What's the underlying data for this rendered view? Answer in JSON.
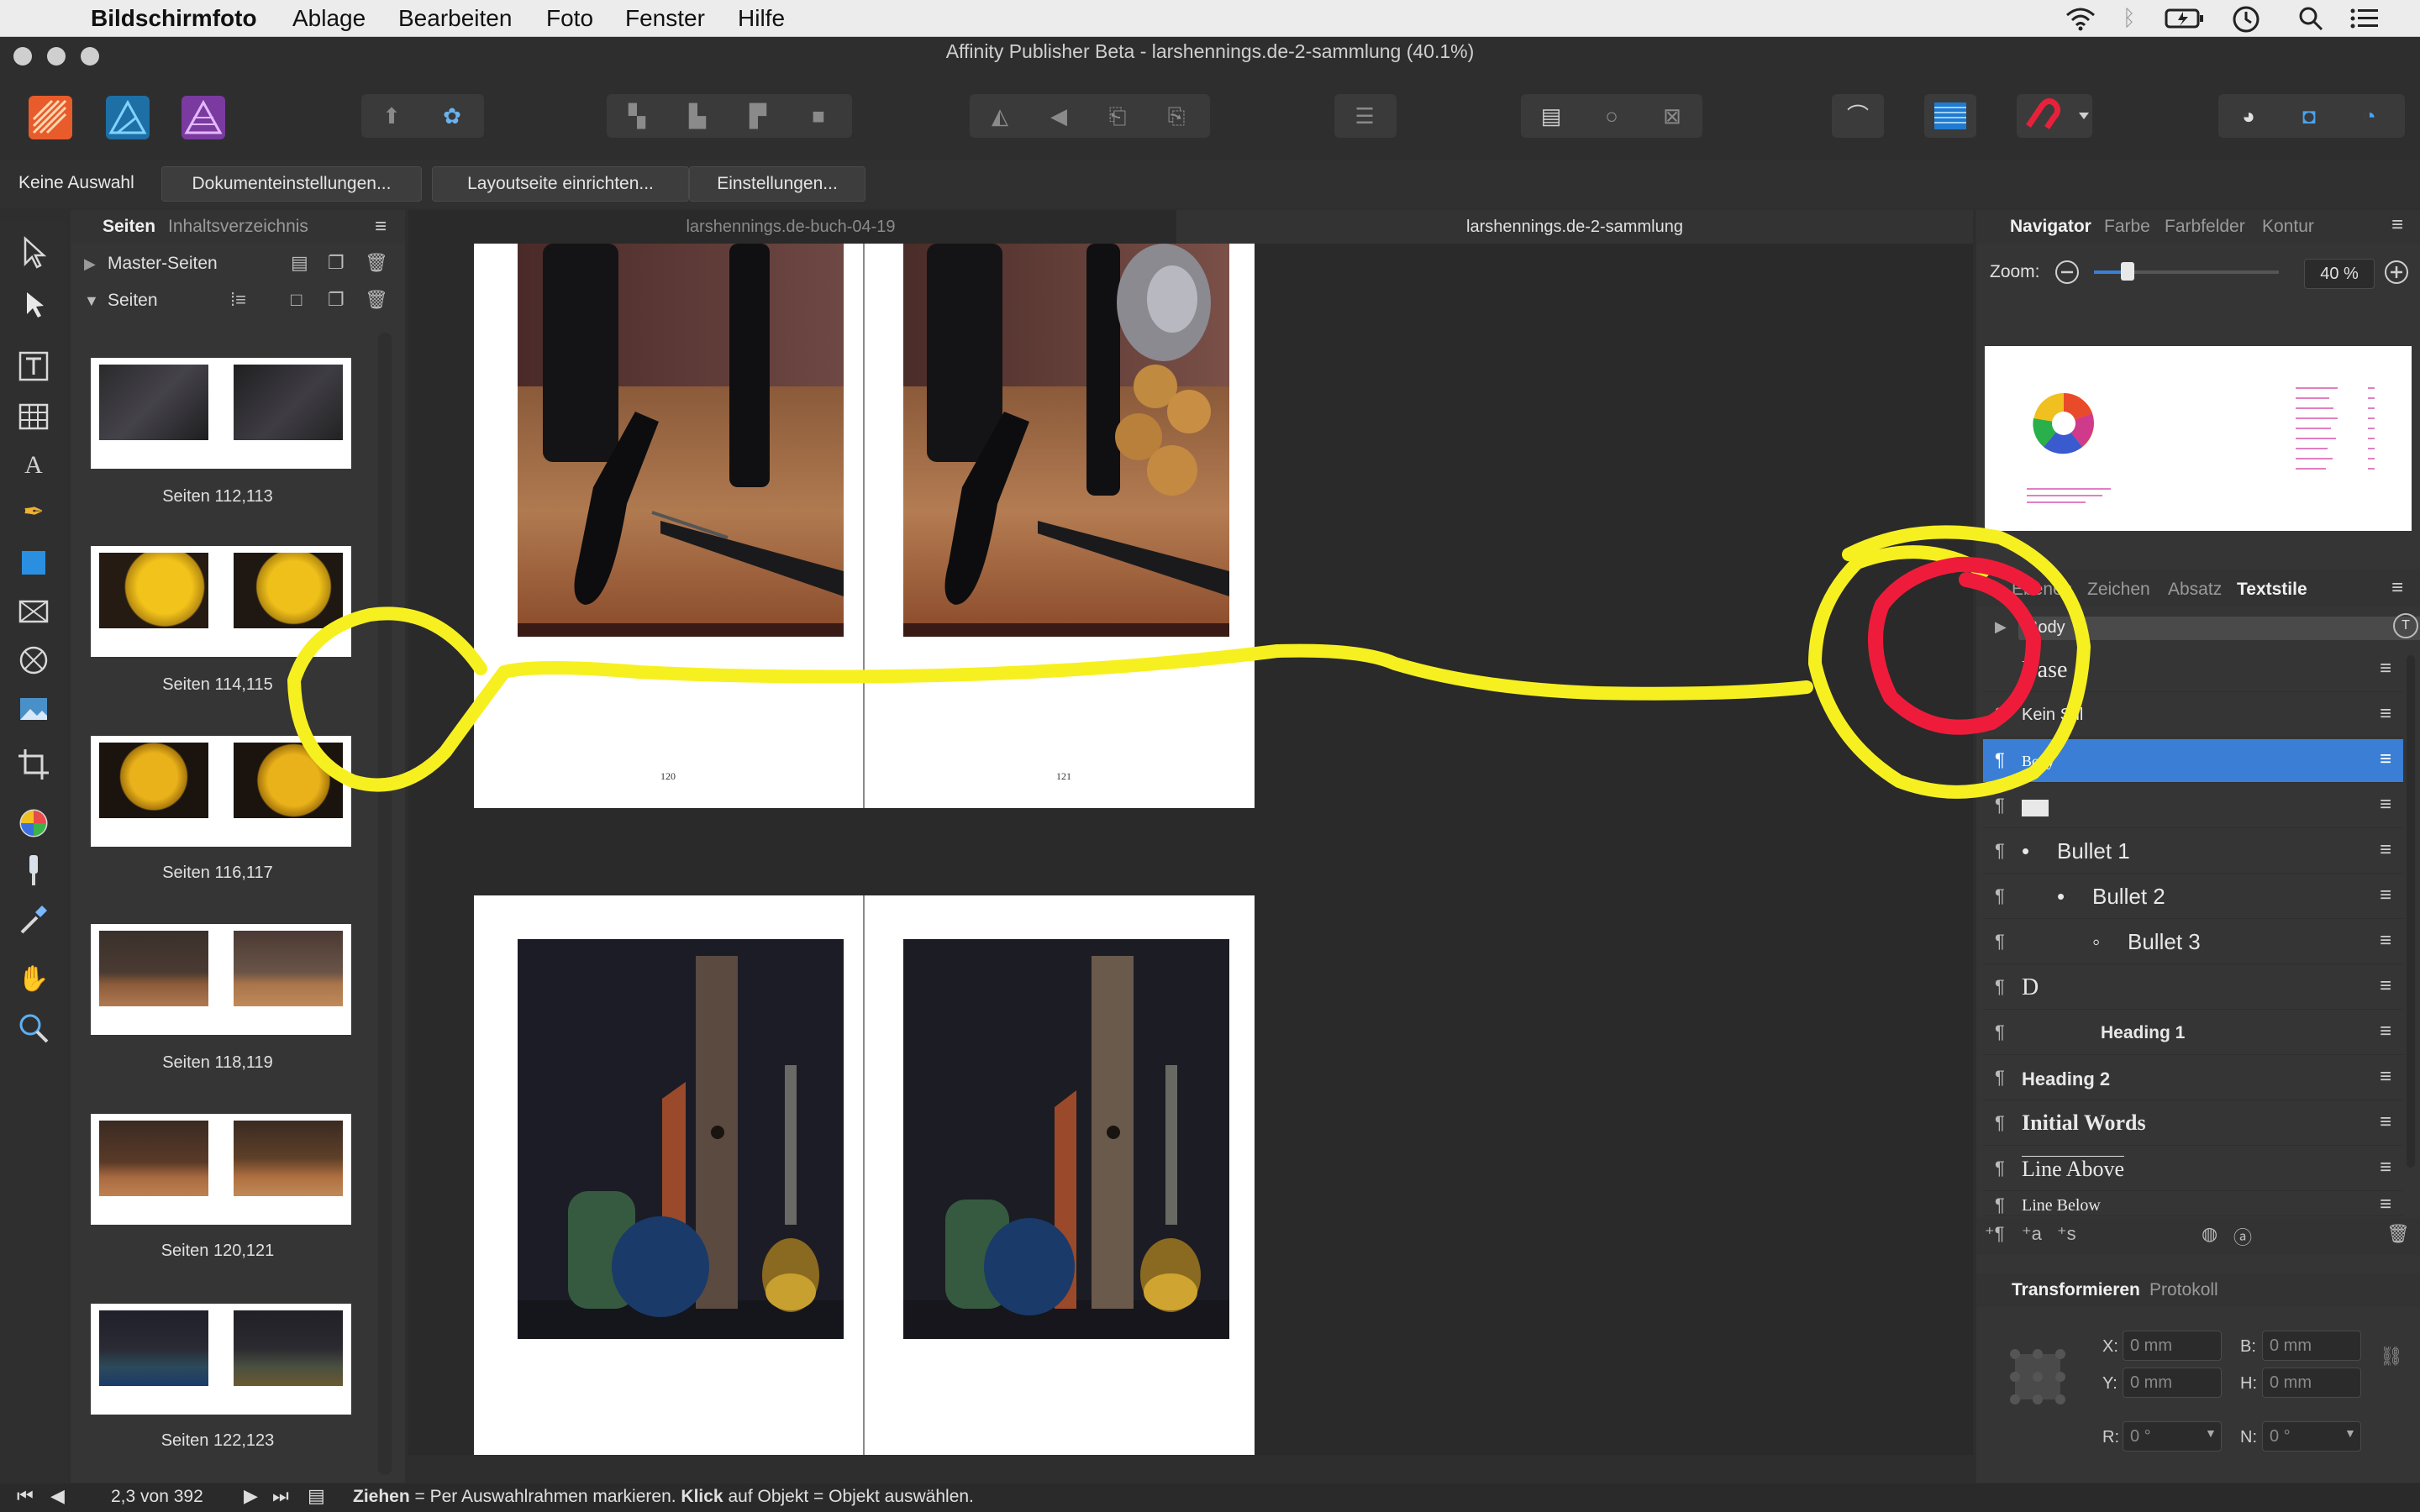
{
  "menubar": {
    "app_name": "Bildschirmfoto",
    "items": [
      "Ablage",
      "Bearbeiten",
      "Foto",
      "Fenster",
      "Hilfe"
    ]
  },
  "window": {
    "title": "Affinity Publisher Beta - larshennings.de-2-sammlung (40.1%)"
  },
  "context_bar": {
    "selection": "Keine Auswahl",
    "buttons": [
      "Dokumenteinstellungen...",
      "Layoutseite einrichten...",
      "Einstellungen..."
    ]
  },
  "pages_panel": {
    "tabs": [
      "Seiten",
      "Inhaltsverzeichnis"
    ],
    "sections": [
      "Master-Seiten",
      "Seiten"
    ],
    "thumbnails": [
      {
        "label": "Seiten 112,113"
      },
      {
        "label": "Seiten 114,115"
      },
      {
        "label": "Seiten 116,117"
      },
      {
        "label": "Seiten 118,119"
      },
      {
        "label": "Seiten 120,121"
      },
      {
        "label": "Seiten 122,123"
      }
    ]
  },
  "document_tabs": [
    "larshennings.de-buch-04-19",
    "larshennings.de-2-sammlung"
  ],
  "canvas": {
    "page_numbers": [
      "120",
      "121"
    ]
  },
  "navigator": {
    "tabs": [
      "Navigator",
      "Farbe",
      "Farbfelder",
      "Kontur"
    ],
    "zoom_label": "Zoom:",
    "zoom_value": "40 %"
  },
  "styles_panel": {
    "tabs": [
      "Ebenen",
      "Zeichen",
      "Absatz",
      "Textstile"
    ],
    "group": "Body",
    "styles": [
      {
        "name": "Base"
      },
      {
        "name": "Kein Stil"
      },
      {
        "name": "Body"
      },
      {
        "name": ""
      },
      {
        "name": "Bullet 1",
        "marker": "•"
      },
      {
        "name": "Bullet 2",
        "marker": "•"
      },
      {
        "name": "Bullet 3",
        "marker": "◦"
      },
      {
        "name": "D"
      },
      {
        "name": "Heading 1"
      },
      {
        "name": "Heading 2"
      },
      {
        "name": "Initial Words"
      },
      {
        "name": "Line Above"
      },
      {
        "name": "Line Below"
      }
    ],
    "selected_index": 2
  },
  "transform_panel": {
    "tabs": [
      "Transformieren",
      "Protokoll"
    ],
    "fields": [
      {
        "label": "X:",
        "value": "0 mm"
      },
      {
        "label": "B:",
        "value": "0 mm"
      },
      {
        "label": "Y:",
        "value": "0 mm"
      },
      {
        "label": "H:",
        "value": "0 mm"
      },
      {
        "label": "R:",
        "value": "0 °"
      },
      {
        "label": "N:",
        "value": "0 °"
      }
    ]
  },
  "statusbar": {
    "page_indicator": "2,3 von 392",
    "hint_bold_1": "Ziehen",
    "hint_text_1": " = Per Auswahlrahmen markieren. ",
    "hint_bold_2": "Klick",
    "hint_text_2": " auf Objekt = Objekt auswählen."
  },
  "colors": {
    "accent": "#3a7fd5",
    "annotation_yellow": "#f7f020",
    "annotation_red": "#ee1c3a"
  }
}
